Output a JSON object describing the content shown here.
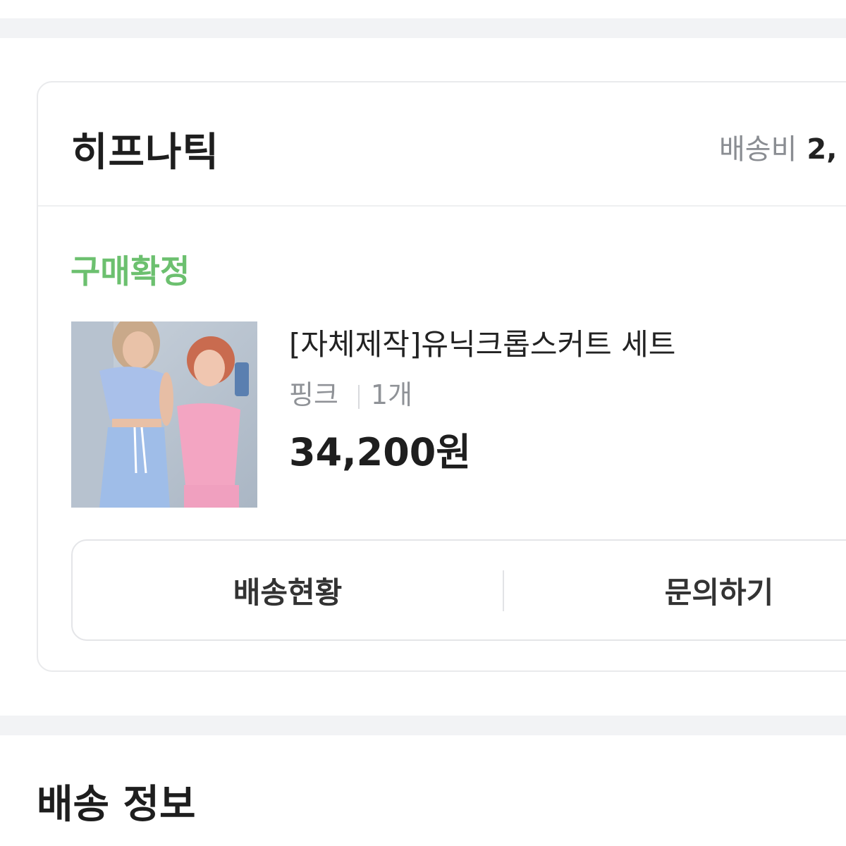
{
  "order": {
    "seller_name": "히프나틱",
    "shipping_fee_label": "배송비",
    "shipping_fee_value": "2,",
    "status": "구매확정",
    "status_color": "#6cc06f",
    "product": {
      "title": "[자체제작]유닉크롭스커트 세트",
      "option_color": "핑크",
      "quantity": "1개",
      "price": "34,200원"
    },
    "actions": {
      "delivery_status_label": "배송현황",
      "inquiry_label": "문의하기"
    }
  },
  "delivery_section": {
    "title": "배송 정보"
  }
}
